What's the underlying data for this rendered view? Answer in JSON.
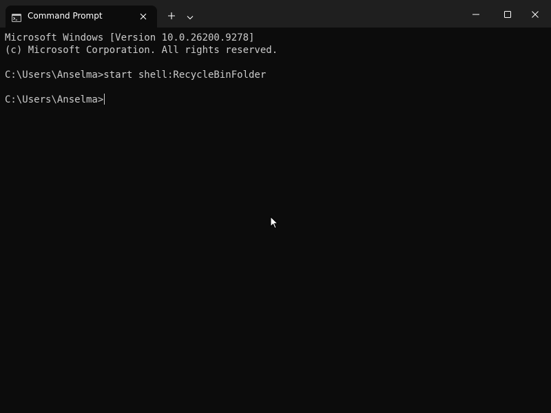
{
  "window": {
    "tab_title": "Command Prompt",
    "icons": {
      "tab_icon": "command-prompt-icon",
      "tab_close": "close-icon",
      "new_tab": "plus-icon",
      "dropdown": "chevron-down-icon",
      "minimize": "minimize-icon",
      "maximize": "maximize-icon",
      "close": "close-icon"
    }
  },
  "console": {
    "lines": [
      "Microsoft Windows [Version 10.0.26200.9278]",
      "(c) Microsoft Corporation. All rights reserved.",
      "",
      "C:\\Users\\Anselma>start shell:RecycleBinFolder",
      "",
      "C:\\Users\\Anselma>"
    ]
  },
  "colors": {
    "background": "#0c0c0c",
    "titlebar": "#1f1f1f",
    "text": "#cccccc",
    "title_text": "#ffffff"
  }
}
